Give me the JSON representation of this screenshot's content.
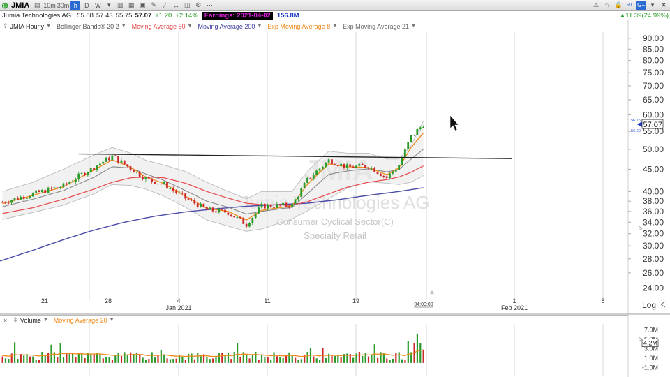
{
  "toolbar": {
    "symbol": "JMIA",
    "intervals": [
      "10m",
      "30m",
      "h",
      "D",
      "W"
    ],
    "active_interval": "h",
    "right_badges": [
      "RT",
      "G+"
    ]
  },
  "info": {
    "company": "Jumia Technologies AG",
    "open": "55.88",
    "high": "57.43",
    "low": "55.75",
    "close": "57.07",
    "change": "+1.20",
    "change_pct": "+2.14%",
    "earnings": "Earnings: 2021-04-02",
    "volume": "156.8M",
    "right_change": "11.39(24.99%)"
  },
  "indicators": [
    {
      "label": "JMIA Hourly",
      "color": "#333333"
    },
    {
      "label": "Bollinger Bands® 20 2",
      "color": "#555555"
    },
    {
      "label": "Moving Average 50",
      "color": "#e8474a"
    },
    {
      "label": "Moving Average 200",
      "color": "#3b3b9e"
    },
    {
      "label": "Exp Moving Average 8",
      "color": "#f08a1c"
    },
    {
      "label": "Exp Moving Average 21",
      "color": "#666666"
    }
  ],
  "watermark": {
    "symbol": "JMIA",
    "company": "Jumia Technologies AG",
    "sector": "Consumer Cyclical Sector(C)",
    "industry": "Specialty Retail"
  },
  "volume_panel": {
    "label": "Volume",
    "ma_label": "Moving Average 20",
    "y_ticks": [
      "7.0M",
      "5.0M",
      "3.0M",
      "1.0M",
      "-1.0M"
    ],
    "current": "4.2M"
  },
  "chart_data": {
    "type": "candlestick",
    "log_scale": true,
    "y_ticks": [
      90,
      85,
      80,
      75,
      70,
      65,
      60,
      55,
      50,
      45,
      40,
      38,
      36,
      34,
      32,
      30,
      28,
      26,
      24
    ],
    "y_tick_labels": [
      "90.00",
      "85.00",
      "80.00",
      "75.00",
      "70.00",
      "65.00",
      "60.00",
      "55.00",
      "50.00",
      "45.00",
      "40.00",
      "38.00",
      "36.00",
      "34.00",
      "32.00",
      "30.00",
      "28.00",
      "26.00",
      "24.00"
    ],
    "y_range": [
      22.5,
      93
    ],
    "last_price": "57.07",
    "last_price_value": 57.07,
    "bid": "56.75",
    "ask": "56.60",
    "x_ticks": [
      "21",
      "28",
      "4",
      "11",
      "19",
      "1",
      "8"
    ],
    "x_month_labels": [
      "Jan 2021",
      "Feb 2021"
    ],
    "x_time_label": "04:00:00",
    "log_label": "Log",
    "candle_count": 139,
    "price_path": [
      [
        0,
        37.8
      ],
      [
        10,
        39.5
      ],
      [
        20,
        41.2
      ],
      [
        30,
        45.5
      ],
      [
        36,
        48.2
      ],
      [
        42,
        45.2
      ],
      [
        47,
        42.8
      ],
      [
        53,
        41.5
      ],
      [
        60,
        38.6
      ],
      [
        67,
        36.3
      ],
      [
        74,
        35.8
      ],
      [
        80,
        33.6
      ],
      [
        85,
        37.0
      ],
      [
        95,
        37.2
      ],
      [
        100,
        42.5
      ],
      [
        107,
        47.2
      ],
      [
        113,
        45.5
      ],
      [
        120,
        45.8
      ],
      [
        126,
        43.0
      ],
      [
        130,
        46.0
      ],
      [
        134,
        53.5
      ],
      [
        138,
        57.07
      ]
    ],
    "trendline": {
      "start": [
        25,
        48.8
      ],
      "end": [
        167,
        47.6
      ]
    },
    "ma_paths": {
      "ema8": [
        [
          0,
          37.5
        ],
        [
          10,
          39.2
        ],
        [
          20,
          41.0
        ],
        [
          30,
          44.8
        ],
        [
          36,
          47.3
        ],
        [
          42,
          45.5
        ],
        [
          47,
          43.2
        ],
        [
          53,
          41.7
        ],
        [
          60,
          39.0
        ],
        [
          67,
          36.6
        ],
        [
          74,
          36.0
        ],
        [
          80,
          34.4
        ],
        [
          85,
          36.2
        ],
        [
          95,
          37.1
        ],
        [
          100,
          41.5
        ],
        [
          107,
          46.3
        ],
        [
          113,
          45.6
        ],
        [
          120,
          45.4
        ],
        [
          126,
          43.7
        ],
        [
          130,
          45.3
        ],
        [
          134,
          50.5
        ],
        [
          138,
          54.5
        ]
      ],
      "ema21": [
        [
          0,
          36.9
        ],
        [
          10,
          38.4
        ],
        [
          20,
          40.2
        ],
        [
          30,
          43.1
        ],
        [
          36,
          45.6
        ],
        [
          42,
          45.3
        ],
        [
          47,
          43.9
        ],
        [
          53,
          42.4
        ],
        [
          60,
          40.2
        ],
        [
          67,
          38.0
        ],
        [
          74,
          36.8
        ],
        [
          80,
          35.5
        ],
        [
          85,
          36.0
        ],
        [
          95,
          36.8
        ],
        [
          100,
          39.5
        ],
        [
          107,
          43.8
        ],
        [
          113,
          44.6
        ],
        [
          120,
          45.1
        ],
        [
          126,
          44.4
        ],
        [
          130,
          44.9
        ],
        [
          134,
          47.5
        ],
        [
          138,
          50.0
        ]
      ],
      "ma50": [
        [
          0,
          35.6
        ],
        [
          10,
          36.7
        ],
        [
          20,
          38.4
        ],
        [
          30,
          40.5
        ],
        [
          36,
          42.0
        ],
        [
          42,
          43.0
        ],
        [
          47,
          43.2
        ],
        [
          53,
          43.0
        ],
        [
          60,
          41.8
        ],
        [
          67,
          40.0
        ],
        [
          74,
          38.6
        ],
        [
          80,
          37.6
        ],
        [
          85,
          37.3
        ],
        [
          95,
          37.2
        ],
        [
          100,
          37.9
        ],
        [
          107,
          39.5
        ],
        [
          113,
          40.9
        ],
        [
          120,
          42.0
        ],
        [
          126,
          42.6
        ],
        [
          130,
          43.2
        ],
        [
          134,
          44.3
        ],
        [
          138,
          45.8
        ]
      ],
      "ma200": [
        [
          -10,
          26.5
        ],
        [
          0,
          27.8
        ],
        [
          10,
          29.3
        ],
        [
          20,
          31.0
        ],
        [
          30,
          32.6
        ],
        [
          40,
          34.0
        ],
        [
          50,
          35.1
        ],
        [
          60,
          35.9
        ],
        [
          70,
          36.5
        ],
        [
          80,
          37.0
        ],
        [
          90,
          37.3
        ],
        [
          100,
          37.6
        ],
        [
          110,
          38.3
        ],
        [
          120,
          39.2
        ],
        [
          130,
          40.0
        ],
        [
          138,
          40.8
        ]
      ]
    },
    "bollinger": {
      "upper": [
        [
          0,
          40.0
        ],
        [
          10,
          42.0
        ],
        [
          20,
          45.0
        ],
        [
          30,
          48.5
        ],
        [
          36,
          50.5
        ],
        [
          42,
          49.0
        ],
        [
          47,
          47.2
        ],
        [
          53,
          46.0
        ],
        [
          60,
          44.5
        ],
        [
          67,
          42.0
        ],
        [
          74,
          40.0
        ],
        [
          80,
          38.5
        ],
        [
          85,
          40.0
        ],
        [
          95,
          40.0
        ],
        [
          100,
          44.5
        ],
        [
          107,
          49.5
        ],
        [
          113,
          49.0
        ],
        [
          120,
          49.0
        ],
        [
          126,
          47.5
        ],
        [
          130,
          47.5
        ],
        [
          134,
          51.0
        ],
        [
          138,
          58.0
        ]
      ],
      "lower": [
        [
          0,
          34.5
        ],
        [
          10,
          35.8
        ],
        [
          20,
          37.2
        ],
        [
          30,
          39.5
        ],
        [
          36,
          41.5
        ],
        [
          42,
          41.3
        ],
        [
          47,
          40.5
        ],
        [
          53,
          39.0
        ],
        [
          60,
          36.8
        ],
        [
          67,
          34.4
        ],
        [
          74,
          33.3
        ],
        [
          80,
          32.4
        ],
        [
          85,
          32.8
        ],
        [
          95,
          34.6
        ],
        [
          100,
          36.1
        ],
        [
          107,
          38.5
        ],
        [
          113,
          40.7
        ],
        [
          120,
          42.1
        ],
        [
          126,
          41.8
        ],
        [
          130,
          41.5
        ],
        [
          134,
          42.0
        ],
        [
          138,
          43.5
        ]
      ]
    }
  }
}
